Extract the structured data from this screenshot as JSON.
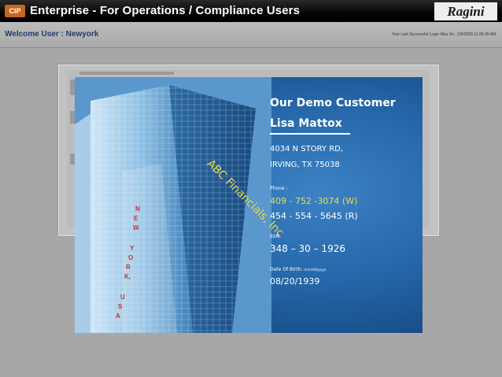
{
  "topbar": {
    "logo": "CIP",
    "title": "Enterprise - For Operations / Compliance Users",
    "brand": "Ragini"
  },
  "welcome": {
    "label": "Welcome User : Newyork",
    "last_login": "Your Last Successful Login Was On : 2/9/2009 11:36:39 AM"
  },
  "card": {
    "company_banner": "ABC Financials, Inc",
    "vertical_location": [
      "N",
      "E",
      "W",
      "Y",
      "O",
      "R",
      "K,",
      "U",
      "S",
      "A"
    ],
    "customer_heading": "Our Demo Customer",
    "customer_name": "Lisa Mattox",
    "address_line1": "4034 N STORY RD,",
    "address_line2": "IRVING, TX 75038",
    "phone_label": "Phone :",
    "phone_work": "409 - 752 -3074  (W)",
    "phone_res": "454 - 554 - 5645  (R)",
    "ssn_label": "SSN:",
    "ssn": "348 – 30 – 1926",
    "dob_label": "Date Of Birth: ",
    "dob_format": "(mm/dd/yyyy)",
    "dob": "08/20/1939"
  },
  "colors": {
    "title_bar": "#000000",
    "card_blue": "#2566a8",
    "highlight_yellow": "#e6df4a",
    "vertical_text_red": "#c5312b"
  }
}
